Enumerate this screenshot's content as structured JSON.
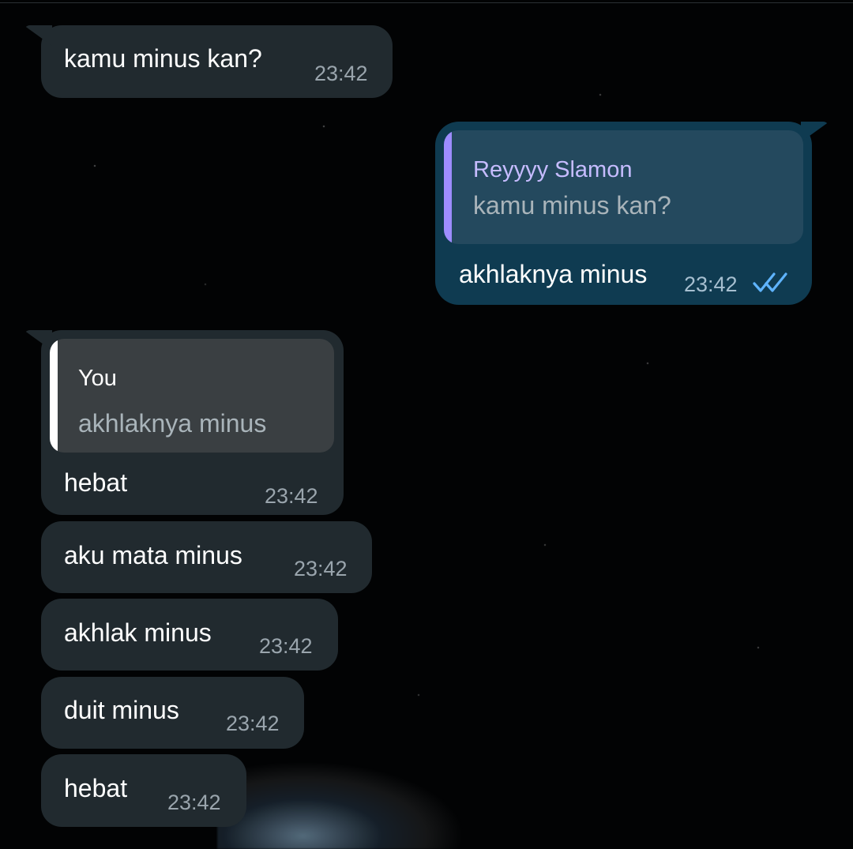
{
  "messages": {
    "m1": {
      "text": "kamu minus kan?",
      "time": "23:42"
    },
    "m2": {
      "reply_name": "Reyyyy Slamon",
      "reply_text": "kamu minus kan?",
      "text": "akhlaknya minus",
      "time": "23:42",
      "status": "double-check-icon"
    },
    "m3": {
      "reply_name": "You",
      "reply_text": "akhlaknya minus",
      "text": "hebat",
      "time": "23:42"
    },
    "m4": {
      "text": "aku mata minus",
      "time": "23:42"
    },
    "m5": {
      "text": "akhlak minus",
      "time": "23:42"
    },
    "m6": {
      "text": "duit minus",
      "time": "23:42"
    },
    "m7": {
      "text": "hebat",
      "time": "23:42"
    }
  },
  "colors": {
    "incoming_bubble": "#212a2f",
    "outgoing_bubble": "#0f3b51",
    "reply_accent": "#9d8cff",
    "check_blue": "#5fb4ff"
  }
}
